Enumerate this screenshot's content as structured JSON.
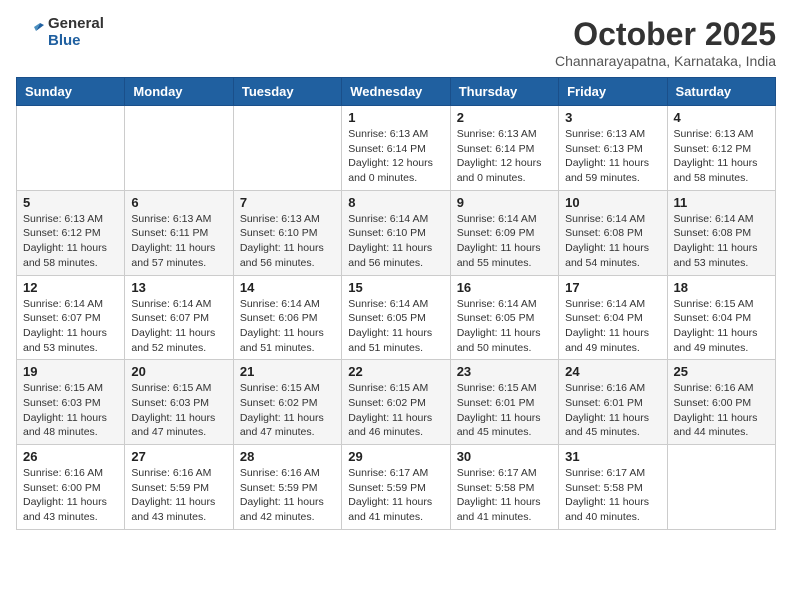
{
  "header": {
    "logo_general": "General",
    "logo_blue": "Blue",
    "month": "October 2025",
    "location": "Channarayapatna, Karnataka, India"
  },
  "weekdays": [
    "Sunday",
    "Monday",
    "Tuesday",
    "Wednesday",
    "Thursday",
    "Friday",
    "Saturday"
  ],
  "weeks": [
    [
      {
        "day": "",
        "info": ""
      },
      {
        "day": "",
        "info": ""
      },
      {
        "day": "",
        "info": ""
      },
      {
        "day": "1",
        "info": "Sunrise: 6:13 AM\nSunset: 6:14 PM\nDaylight: 12 hours\nand 0 minutes."
      },
      {
        "day": "2",
        "info": "Sunrise: 6:13 AM\nSunset: 6:14 PM\nDaylight: 12 hours\nand 0 minutes."
      },
      {
        "day": "3",
        "info": "Sunrise: 6:13 AM\nSunset: 6:13 PM\nDaylight: 11 hours\nand 59 minutes."
      },
      {
        "day": "4",
        "info": "Sunrise: 6:13 AM\nSunset: 6:12 PM\nDaylight: 11 hours\nand 58 minutes."
      }
    ],
    [
      {
        "day": "5",
        "info": "Sunrise: 6:13 AM\nSunset: 6:12 PM\nDaylight: 11 hours\nand 58 minutes."
      },
      {
        "day": "6",
        "info": "Sunrise: 6:13 AM\nSunset: 6:11 PM\nDaylight: 11 hours\nand 57 minutes."
      },
      {
        "day": "7",
        "info": "Sunrise: 6:13 AM\nSunset: 6:10 PM\nDaylight: 11 hours\nand 56 minutes."
      },
      {
        "day": "8",
        "info": "Sunrise: 6:14 AM\nSunset: 6:10 PM\nDaylight: 11 hours\nand 56 minutes."
      },
      {
        "day": "9",
        "info": "Sunrise: 6:14 AM\nSunset: 6:09 PM\nDaylight: 11 hours\nand 55 minutes."
      },
      {
        "day": "10",
        "info": "Sunrise: 6:14 AM\nSunset: 6:08 PM\nDaylight: 11 hours\nand 54 minutes."
      },
      {
        "day": "11",
        "info": "Sunrise: 6:14 AM\nSunset: 6:08 PM\nDaylight: 11 hours\nand 53 minutes."
      }
    ],
    [
      {
        "day": "12",
        "info": "Sunrise: 6:14 AM\nSunset: 6:07 PM\nDaylight: 11 hours\nand 53 minutes."
      },
      {
        "day": "13",
        "info": "Sunrise: 6:14 AM\nSunset: 6:07 PM\nDaylight: 11 hours\nand 52 minutes."
      },
      {
        "day": "14",
        "info": "Sunrise: 6:14 AM\nSunset: 6:06 PM\nDaylight: 11 hours\nand 51 minutes."
      },
      {
        "day": "15",
        "info": "Sunrise: 6:14 AM\nSunset: 6:05 PM\nDaylight: 11 hours\nand 51 minutes."
      },
      {
        "day": "16",
        "info": "Sunrise: 6:14 AM\nSunset: 6:05 PM\nDaylight: 11 hours\nand 50 minutes."
      },
      {
        "day": "17",
        "info": "Sunrise: 6:14 AM\nSunset: 6:04 PM\nDaylight: 11 hours\nand 49 minutes."
      },
      {
        "day": "18",
        "info": "Sunrise: 6:15 AM\nSunset: 6:04 PM\nDaylight: 11 hours\nand 49 minutes."
      }
    ],
    [
      {
        "day": "19",
        "info": "Sunrise: 6:15 AM\nSunset: 6:03 PM\nDaylight: 11 hours\nand 48 minutes."
      },
      {
        "day": "20",
        "info": "Sunrise: 6:15 AM\nSunset: 6:03 PM\nDaylight: 11 hours\nand 47 minutes."
      },
      {
        "day": "21",
        "info": "Sunrise: 6:15 AM\nSunset: 6:02 PM\nDaylight: 11 hours\nand 47 minutes."
      },
      {
        "day": "22",
        "info": "Sunrise: 6:15 AM\nSunset: 6:02 PM\nDaylight: 11 hours\nand 46 minutes."
      },
      {
        "day": "23",
        "info": "Sunrise: 6:15 AM\nSunset: 6:01 PM\nDaylight: 11 hours\nand 45 minutes."
      },
      {
        "day": "24",
        "info": "Sunrise: 6:16 AM\nSunset: 6:01 PM\nDaylight: 11 hours\nand 45 minutes."
      },
      {
        "day": "25",
        "info": "Sunrise: 6:16 AM\nSunset: 6:00 PM\nDaylight: 11 hours\nand 44 minutes."
      }
    ],
    [
      {
        "day": "26",
        "info": "Sunrise: 6:16 AM\nSunset: 6:00 PM\nDaylight: 11 hours\nand 43 minutes."
      },
      {
        "day": "27",
        "info": "Sunrise: 6:16 AM\nSunset: 5:59 PM\nDaylight: 11 hours\nand 43 minutes."
      },
      {
        "day": "28",
        "info": "Sunrise: 6:16 AM\nSunset: 5:59 PM\nDaylight: 11 hours\nand 42 minutes."
      },
      {
        "day": "29",
        "info": "Sunrise: 6:17 AM\nSunset: 5:59 PM\nDaylight: 11 hours\nand 41 minutes."
      },
      {
        "day": "30",
        "info": "Sunrise: 6:17 AM\nSunset: 5:58 PM\nDaylight: 11 hours\nand 41 minutes."
      },
      {
        "day": "31",
        "info": "Sunrise: 6:17 AM\nSunset: 5:58 PM\nDaylight: 11 hours\nand 40 minutes."
      },
      {
        "day": "",
        "info": ""
      }
    ]
  ]
}
